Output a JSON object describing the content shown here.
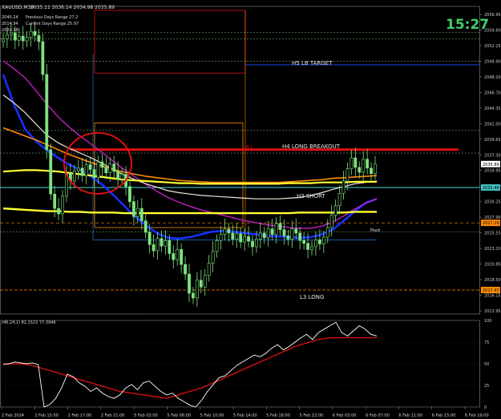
{
  "window": {
    "symbol_title": "XAUUSD,M30"
  },
  "header": {
    "ohlc": "2035.11 2036.14 2034.98 2035.89",
    "info_lines": [
      [
        "2040.24",
        "Previous Days Range 27.2"
      ],
      [
        "2014.94",
        "Current Days Range 25.97"
      ]
    ],
    "third_line": "2024.98"
  },
  "clock": "15:27",
  "colors": {
    "background": "#000000",
    "grid": "#2a2a2a",
    "candle": "#7fe37f",
    "clock": "#3fd06b",
    "ma_blue": "#1530ff",
    "ma_magenta": "#c020c0",
    "ma_orange": "#ff8c00",
    "ma_white": "#f0e6d8",
    "ma_yellow": "#ffff33",
    "breakout_line": "#e01010",
    "short_line": "#40c0c0",
    "stoch_main": "#ffffff",
    "stoch_signal": "#d01010",
    "price_label": "#1e8fff"
  },
  "level_labels": {
    "h5": "H5 LB TARGET",
    "h4": "H4 LONG BREAKOUT",
    "h3": "H3 SHORT",
    "l3": "L3 LONG",
    "pivot": "Pivot",
    "r1": "R 1"
  },
  "price_badges": [
    {
      "label": "2035.89",
      "price": 2035.89,
      "color": "#ffffff",
      "text_color": "#000000"
    },
    {
      "label": "2032.46",
      "price": 2032.46,
      "color": "#40c0c0",
      "text_color": "#000000"
    },
    {
      "label": "2027.29",
      "price": 2027.29,
      "color": "#ff8c00",
      "text_color": "#000000"
    },
    {
      "label": "2017.47",
      "price": 2017.47,
      "color": "#ff8c00",
      "text_color": "#000000"
    }
  ],
  "indicator": {
    "label": "(46,24,1) 81.1522 77.3946"
  },
  "chart_data": [
    {
      "type": "candlestick",
      "ylim": [
        2013.95,
        2058.95
      ],
      "y_ticks": [
        "2056.95",
        "2054.60",
        "2052.25",
        "2049.90",
        "2048.20",
        "2046.70",
        "2044.35",
        "2042.00",
        "2039.65",
        "2037.30",
        "2034.95",
        "2032.60",
        "2030.25",
        "2027.90",
        "2025.55",
        "2023.20",
        "2020.85",
        "2018.50",
        "2016.15",
        "2013.95"
      ],
      "x_ticks": [
        "2 Feb 2024",
        "2 Feb 15:00",
        "2 Feb 17:00",
        "2 Feb 21:00",
        "5 Feb 02:00",
        "5 Feb 06:00",
        "5 Feb 10:00",
        "5 Feb 14:00",
        "5 Feb 18:00",
        "5 Feb 22:00",
        "6 Feb 03:00",
        "6 Feb 07:00",
        "6 Feb 11:00",
        "6 Feb 15:00",
        "6 Feb 19:00"
      ],
      "close": [
        2054.2,
        2054.8,
        2055.1,
        2054.0,
        2054.6,
        2053.9,
        2054.4,
        2055.3,
        2054.7,
        2053.8,
        2049.0,
        2038.0,
        2031.5,
        2029.4,
        2028.6,
        2031.2,
        2034.5,
        2033.4,
        2034.9,
        2035.3,
        2034.2,
        2035.8,
        2035.1,
        2033.9,
        2036.2,
        2035.4,
        2034.6,
        2035.9,
        2034.8,
        2033.7,
        2034.4,
        2032.6,
        2030.4,
        2028.2,
        2029.4,
        2027.6,
        2025.9,
        2024.1,
        2023.2,
        2025.0,
        2023.9,
        2024.7,
        2022.8,
        2021.9,
        2023.4,
        2021.2,
        2019.8,
        2017.0,
        2016.3,
        2018.9,
        2017.9,
        2019.6,
        2021.4,
        2023.1,
        2024.7,
        2025.6,
        2026.4,
        2025.8,
        2024.9,
        2025.7,
        2024.5,
        2025.3,
        2024.6,
        2023.8,
        2024.9,
        2025.8,
        2025.1,
        2026.4,
        2025.6,
        2027.2,
        2026.3,
        2025.4,
        2024.9,
        2026.4,
        2025.8,
        2024.7,
        2024.3,
        2023.4,
        2023.8,
        2024.8,
        2024.2,
        2025.2,
        2026.6,
        2028.4,
        2029.8,
        2031.6,
        2033.4,
        2035.2,
        2036.8,
        2035.4,
        2034.7,
        2036.6,
        2035.3,
        2034.5,
        2035.89
      ],
      "ma": [
        {
          "name": "blue",
          "values": [
            2049.0,
            2044.5,
            2041.0,
            2039.2,
            2037.9,
            2036.8,
            2035.8,
            2035.0,
            2034.1,
            2032.9,
            2031.4,
            2029.8,
            2028.2,
            2026.9,
            2025.8,
            2025.1,
            2025.0,
            2025.2,
            2025.6,
            2026.0,
            2026.1,
            2026.0,
            2025.8,
            2025.6,
            2025.4,
            2025.3,
            2025.2,
            2025.1,
            2025.2,
            2025.6,
            2026.3,
            2027.6,
            2029.0,
            2030.2,
            2030.8
          ]
        },
        {
          "name": "magenta",
          "values": [
            2051.0,
            2049.8,
            2048.5,
            2046.6,
            2044.6,
            2042.8,
            2041.3,
            2040.0,
            2038.8,
            2037.6,
            2036.3,
            2035.1,
            2034.0,
            2032.9,
            2031.9,
            2031.0,
            2030.3,
            2029.7,
            2029.2,
            2028.8,
            2028.4,
            2028.0,
            2027.6,
            2027.3,
            2027.0,
            2026.8,
            2026.6,
            2026.5,
            2026.5,
            2026.8,
            2027.4,
            2028.3,
            2029.3,
            2030.2,
            2030.8
          ]
        },
        {
          "name": "white",
          "values": [
            2046.0,
            2044.8,
            2043.4,
            2041.7,
            2040.1,
            2039.0,
            2038.2,
            2037.5,
            2036.8,
            2036.0,
            2035.1,
            2034.3,
            2033.6,
            2033.0,
            2032.5,
            2032.0,
            2031.7,
            2031.5,
            2031.3,
            2031.2,
            2031.1,
            2031.0,
            2030.9,
            2030.8,
            2030.8,
            2030.8,
            2030.9,
            2031.0,
            2031.3,
            2031.7,
            2032.2,
            2032.6,
            2033.0,
            2033.2,
            2033.4
          ]
        },
        {
          "name": "orange",
          "values": [
            2041.2,
            2040.6,
            2040.0,
            2039.4,
            2038.7,
            2038.0,
            2037.3,
            2036.7,
            2036.1,
            2035.6,
            2035.1,
            2034.7,
            2034.4,
            2034.1,
            2033.9,
            2033.7,
            2033.5,
            2033.4,
            2033.3,
            2033.2,
            2033.2,
            2033.2,
            2033.2,
            2033.2,
            2033.2,
            2033.2,
            2033.3,
            2033.4,
            2033.5,
            2033.6,
            2033.8,
            2033.9,
            2034.0,
            2034.1,
            2034.2
          ]
        },
        {
          "name": "yellow_upper",
          "values": [
            2034.8,
            2034.9,
            2035.0,
            2035.0,
            2034.9,
            2034.8,
            2034.6,
            2034.4,
            2034.2,
            2034.0,
            2033.8,
            2033.6,
            2033.5,
            2033.4,
            2033.3,
            2033.2,
            2033.1,
            2033.1,
            2033.0,
            2033.0,
            2033.0,
            2033.0,
            2033.0,
            2033.0,
            2033.0,
            2033.0,
            2033.1,
            2033.1,
            2033.1,
            2033.2,
            2033.2,
            2033.2,
            2033.3,
            2033.3,
            2033.3
          ]
        },
        {
          "name": "yellow_lower",
          "values": [
            2029.4,
            2029.3,
            2029.2,
            2029.1,
            2029.0,
            2029.0,
            2028.9,
            2028.9,
            2028.8,
            2028.8,
            2028.8,
            2028.7,
            2028.7,
            2028.7,
            2028.7,
            2028.7,
            2028.7,
            2028.7,
            2028.7,
            2028.7,
            2028.7,
            2028.7,
            2028.7,
            2028.7,
            2028.7,
            2028.7,
            2028.7,
            2028.8,
            2028.8,
            2028.8,
            2028.8,
            2028.8,
            2028.9,
            2028.9,
            2028.9
          ]
        }
      ],
      "levels": {
        "h5_target": 2050.4,
        "h4_breakout": 2038.0,
        "h3_short": 2032.46,
        "pivot": 2027.29,
        "l3_long": 2017.47
      }
    },
    {
      "type": "line",
      "ylim": [
        0,
        100
      ],
      "y_ticks": [
        "100",
        "75",
        "50",
        "25",
        "0"
      ],
      "series": [
        {
          "name": "main",
          "values": [
            49,
            50,
            52,
            51,
            50,
            51,
            49,
            0,
            3,
            10,
            22,
            38,
            35,
            28,
            24,
            18,
            22,
            16,
            12,
            10,
            14,
            22,
            26,
            20,
            28,
            30,
            24,
            18,
            14,
            16,
            10,
            6,
            2,
            0,
            8,
            18,
            26,
            34,
            36,
            42,
            48,
            52,
            56,
            60,
            58,
            62,
            68,
            72,
            66,
            70,
            75,
            80,
            84,
            78,
            86,
            90,
            94,
            98,
            86,
            82,
            88,
            94,
            90,
            84,
            82
          ]
        },
        {
          "name": "signal",
          "values": [
            50,
            50,
            50,
            50,
            49,
            48,
            46,
            44,
            42,
            40,
            38,
            36,
            34,
            32,
            30,
            28,
            26,
            24,
            22,
            20,
            18,
            17,
            16,
            15,
            14,
            13,
            12,
            11,
            10,
            12,
            14,
            16,
            18,
            20,
            22,
            25,
            28,
            31,
            34,
            37,
            40,
            43,
            46,
            49,
            52,
            55,
            58,
            61,
            64,
            67,
            70,
            72,
            74,
            76,
            78,
            79,
            80,
            80,
            80,
            80,
            80,
            80,
            80,
            80,
            80
          ]
        }
      ]
    }
  ]
}
